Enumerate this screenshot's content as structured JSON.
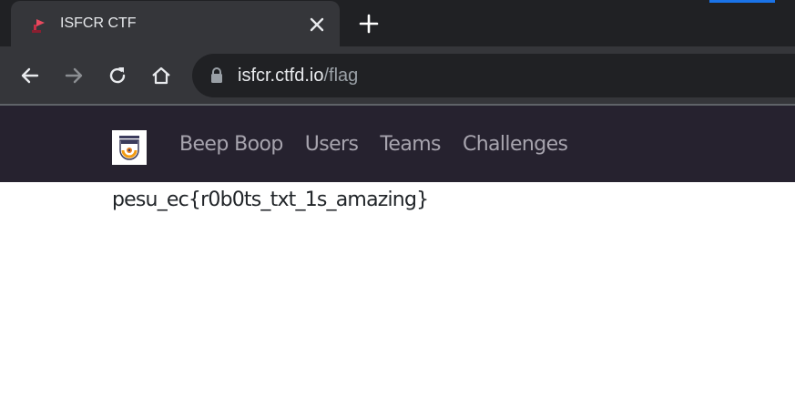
{
  "browser": {
    "tab": {
      "title": "ISFCR CTF",
      "favicon": "ctfd-favicon",
      "close_icon": "close-icon"
    },
    "new_tab_icon": "plus-icon",
    "toolbar": {
      "back_icon": "back-arrow-icon",
      "forward_icon": "forward-arrow-icon",
      "reload_icon": "reload-icon",
      "home_icon": "home-icon"
    },
    "address_bar": {
      "host": "isfcr.ctfd.io",
      "path": "/flag",
      "security_icon": "lock-icon"
    }
  },
  "site": {
    "navbar": {
      "logo": "isfcr-logo",
      "links": [
        {
          "label": "Beep Boop"
        },
        {
          "label": "Users"
        },
        {
          "label": "Teams"
        },
        {
          "label": "Challenges"
        }
      ]
    },
    "content": {
      "flag": "pesu_ec{r0b0ts_txt_1s_amazing}"
    }
  },
  "colors": {
    "tabstrip": "#202124",
    "toolbar": "#35363a",
    "navbar": "#26222f",
    "nav_link": "#a7a4ae",
    "text": "#212529"
  }
}
